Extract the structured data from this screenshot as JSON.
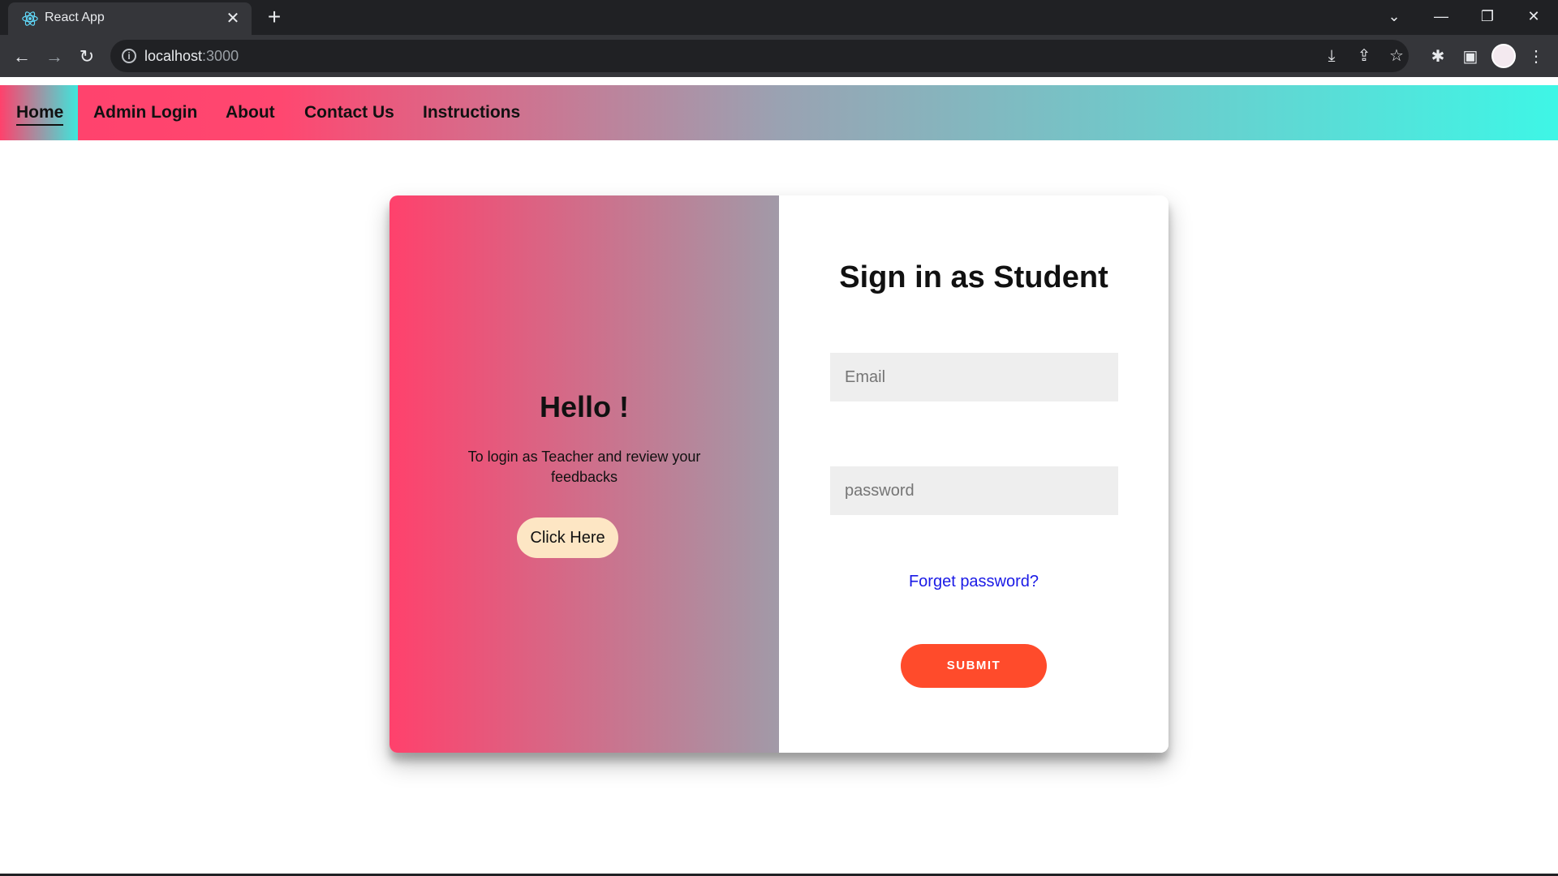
{
  "browser": {
    "tab_title": "React App",
    "url_host": "localhost",
    "url_port": ":3000",
    "tab_close": "✕",
    "new_tab": "+",
    "icons": [
      "react-favicon",
      "back-arrow-icon",
      "forward-arrow-icon",
      "reload-icon",
      "info-icon",
      "install-icon",
      "share-icon",
      "star-icon",
      "extensions-icon",
      "side-panel-icon",
      "profile-avatar",
      "more-menu-icon"
    ]
  },
  "navbar": {
    "items": [
      {
        "label": "Home",
        "active": true
      },
      {
        "label": "Admin Login"
      },
      {
        "label": "About"
      },
      {
        "label": "Contact Us"
      },
      {
        "label": "Instructions"
      }
    ]
  },
  "left_panel": {
    "heading": "Hello !",
    "subtext": "To login as Teacher and review your feedbacks",
    "button_label": "Click Here"
  },
  "right_panel": {
    "heading": "Sign in as Student",
    "email_placeholder": "Email",
    "password_placeholder": "password",
    "forget_link": "Forget password?",
    "submit_label": "SUBMIT"
  },
  "colors": {
    "gradient_start": "#ff416c",
    "gradient_end": "#3ef6e6",
    "submit": "#ff4b2b",
    "click_button": "#fde6c4",
    "link": "#1a1ae6"
  }
}
